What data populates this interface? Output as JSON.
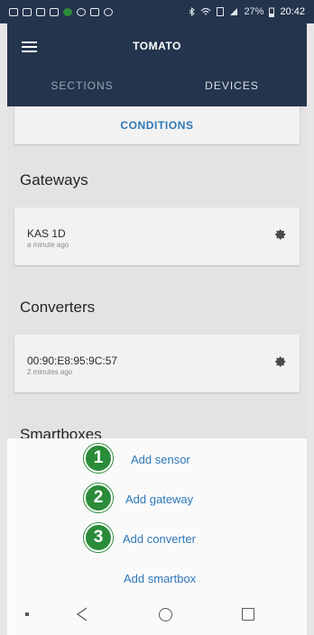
{
  "status_bar": {
    "battery_percent": "27%",
    "time": "20:42"
  },
  "app_bar": {
    "title": "TOMATO",
    "tabs": [
      {
        "label": "SECTIONS",
        "selected": false
      },
      {
        "label": "DEVICES",
        "selected": true
      }
    ]
  },
  "content": {
    "conditions_label": "CONDITIONS",
    "gateways": {
      "title": "Gateways",
      "items": [
        {
          "name": "KAS 1D",
          "time": "a minute ago"
        }
      ]
    },
    "converters": {
      "title": "Converters",
      "items": [
        {
          "name": "00:90:E8:95:9C:57",
          "time": "2 minutes ago"
        }
      ]
    },
    "smartboxes": {
      "title": "Smartboxes"
    }
  },
  "sheet": {
    "items": [
      {
        "badge": "1",
        "label": "Add sensor"
      },
      {
        "badge": "2",
        "label": "Add gateway"
      },
      {
        "badge": "3",
        "label": "Add converter"
      },
      {
        "label": "Add smartbox"
      }
    ]
  },
  "colors": {
    "app_bar": "#24344d",
    "accent_blue": "#2d78b9",
    "badge_green": "#2a8c39"
  }
}
